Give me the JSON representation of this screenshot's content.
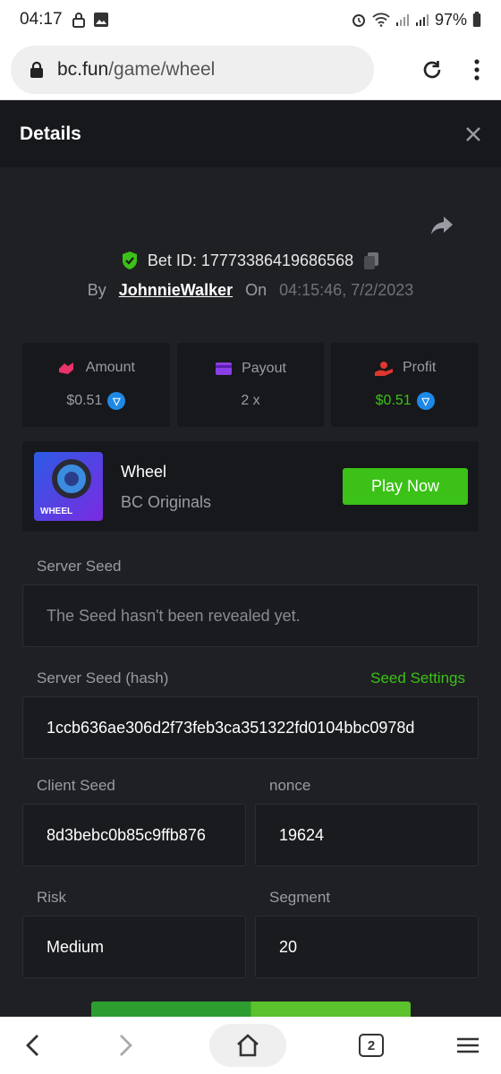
{
  "status_bar": {
    "time": "04:17",
    "battery": "97%"
  },
  "browser": {
    "url_host": "bc.fun",
    "url_path": "/game/wheel",
    "tab_count": "2"
  },
  "modal": {
    "title": "Details",
    "bet_id_label": "Bet ID: 17773386419686568",
    "by_label": "By",
    "username": "JohnnieWalker",
    "on_label": "On",
    "datetime": "04:15:46, 7/2/2023"
  },
  "stats": {
    "amount": {
      "label": "Amount",
      "value": "$0.51"
    },
    "payout": {
      "label": "Payout",
      "value": "2 x"
    },
    "profit": {
      "label": "Profit",
      "value": "$0.51"
    }
  },
  "game": {
    "name": "Wheel",
    "provider": "BC Originals",
    "thumb_text": "WHEEL",
    "play_label": "Play Now"
  },
  "fields": {
    "server_seed_label": "Server Seed",
    "server_seed_value": "The Seed hasn't been revealed yet.",
    "server_seed_hash_label": "Server Seed (hash)",
    "seed_settings_label": "Seed Settings",
    "server_seed_hash_value": "1ccb636ae306d2f73feb3ca351322fd0104bbc0978d",
    "client_seed_label": "Client Seed",
    "client_seed_value": "8d3bebc0b85c9ffb876",
    "nonce_label": "nonce",
    "nonce_value": "19624",
    "risk_label": "Risk",
    "risk_value": "Medium",
    "segment_label": "Segment",
    "segment_value": "20"
  },
  "colors": {
    "accent_green": "#3bc117",
    "amount_pink": "#e8336b",
    "payout_purple": "#8b3ee6",
    "profit_red": "#e0362c"
  }
}
